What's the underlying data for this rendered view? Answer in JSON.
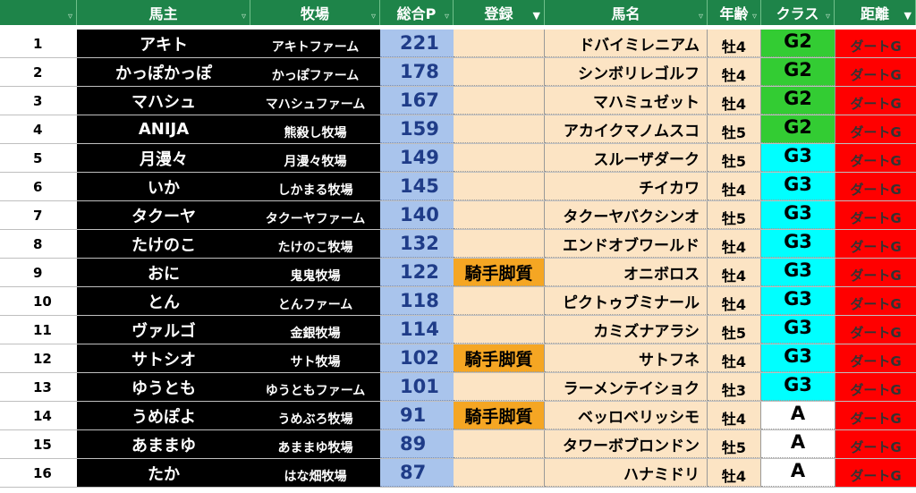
{
  "header": {
    "num": "",
    "owner": "馬主",
    "farm": "牧場",
    "points": "総合P",
    "registration": "登録",
    "horse": "馬名",
    "age": "年齢",
    "class": "クラス",
    "distance": "距離"
  },
  "colors": {
    "header_bg": "#1e8449",
    "points_bg": "#a9c4ec",
    "peach_bg": "#fce4c4",
    "registration_tag_bg": "#f5a623",
    "class_G2": "#33cc33",
    "class_G3": "#00ffff",
    "class_A": "#ffffff",
    "distance_bg": "#ff0000"
  },
  "rows": [
    {
      "num": "1",
      "owner": "アキト",
      "farm": "アキトファーム",
      "points": "221",
      "registration": "",
      "horse": "ドバイミレニアム",
      "age": "牡4",
      "class": "G2",
      "distance": "ダートG"
    },
    {
      "num": "2",
      "owner": "かっぽかっぽ",
      "farm": "かっぽファーム",
      "points": "178",
      "registration": "",
      "horse": "シンボリレゴルフ",
      "age": "牡4",
      "class": "G2",
      "distance": "ダートG"
    },
    {
      "num": "3",
      "owner": "マハシュ",
      "farm": "マハシュファーム",
      "points": "167",
      "registration": "",
      "horse": "マハミュゼット",
      "age": "牡4",
      "class": "G2",
      "distance": "ダートG"
    },
    {
      "num": "4",
      "owner": "ANIJA",
      "farm": "熊殺し牧場",
      "points": "159",
      "registration": "",
      "horse": "アカイクマノムスコ",
      "age": "牡5",
      "class": "G2",
      "distance": "ダートG"
    },
    {
      "num": "5",
      "owner": "月漫々",
      "farm": "月漫々牧場",
      "points": "149",
      "registration": "",
      "horse": "スルーザダーク",
      "age": "牡5",
      "class": "G3",
      "distance": "ダートG"
    },
    {
      "num": "6",
      "owner": "いか",
      "farm": "しかまる牧場",
      "points": "145",
      "registration": "",
      "horse": "チイカワ",
      "age": "牡4",
      "class": "G3",
      "distance": "ダートG"
    },
    {
      "num": "7",
      "owner": "タクーヤ",
      "farm": "タクーヤファーム",
      "points": "140",
      "registration": "",
      "horse": "タクーヤバクシンオ",
      "age": "牡5",
      "class": "G3",
      "distance": "ダートG"
    },
    {
      "num": "8",
      "owner": "たけのこ",
      "farm": "たけのこ牧場",
      "points": "132",
      "registration": "",
      "horse": "エンドオブワールド",
      "age": "牡4",
      "class": "G3",
      "distance": "ダートG"
    },
    {
      "num": "9",
      "owner": "おに",
      "farm": "鬼鬼牧場",
      "points": "122",
      "registration": "騎手脚質",
      "horse": "オニボロス",
      "age": "牡4",
      "class": "G3",
      "distance": "ダートG"
    },
    {
      "num": "10",
      "owner": "とん",
      "farm": "とんファーム",
      "points": "118",
      "registration": "",
      "horse": "ピクトゥブミナール",
      "age": "牡4",
      "class": "G3",
      "distance": "ダートG"
    },
    {
      "num": "11",
      "owner": "ヴァルゴ",
      "farm": "金銀牧場",
      "points": "114",
      "registration": "",
      "horse": "カミズナアラシ",
      "age": "牡5",
      "class": "G3",
      "distance": "ダートG"
    },
    {
      "num": "12",
      "owner": "サトシオ",
      "farm": "サト牧場",
      "points": "102",
      "registration": "騎手脚質",
      "horse": "サトフネ",
      "age": "牡4",
      "class": "G3",
      "distance": "ダートG"
    },
    {
      "num": "13",
      "owner": "ゆうとも",
      "farm": "ゆうともファーム",
      "points": "101",
      "registration": "",
      "horse": "ラーメンテイショク",
      "age": "牡3",
      "class": "G3",
      "distance": "ダートG"
    },
    {
      "num": "14",
      "owner": "うめぽよ",
      "farm": "うめぶろ牧場",
      "points": "91",
      "registration": "騎手脚質",
      "horse": "ベッロベリッシモ",
      "age": "牡4",
      "class": "A",
      "distance": "ダートG"
    },
    {
      "num": "15",
      "owner": "あままゆ",
      "farm": "あままゆ牧場",
      "points": "89",
      "registration": "",
      "horse": "タワーボブロンドン",
      "age": "牡5",
      "class": "A",
      "distance": "ダートG"
    },
    {
      "num": "16",
      "owner": "たか",
      "farm": "はな畑牧場",
      "points": "87",
      "registration": "",
      "horse": "ハナミドリ",
      "age": "牡4",
      "class": "A",
      "distance": "ダートG"
    }
  ]
}
